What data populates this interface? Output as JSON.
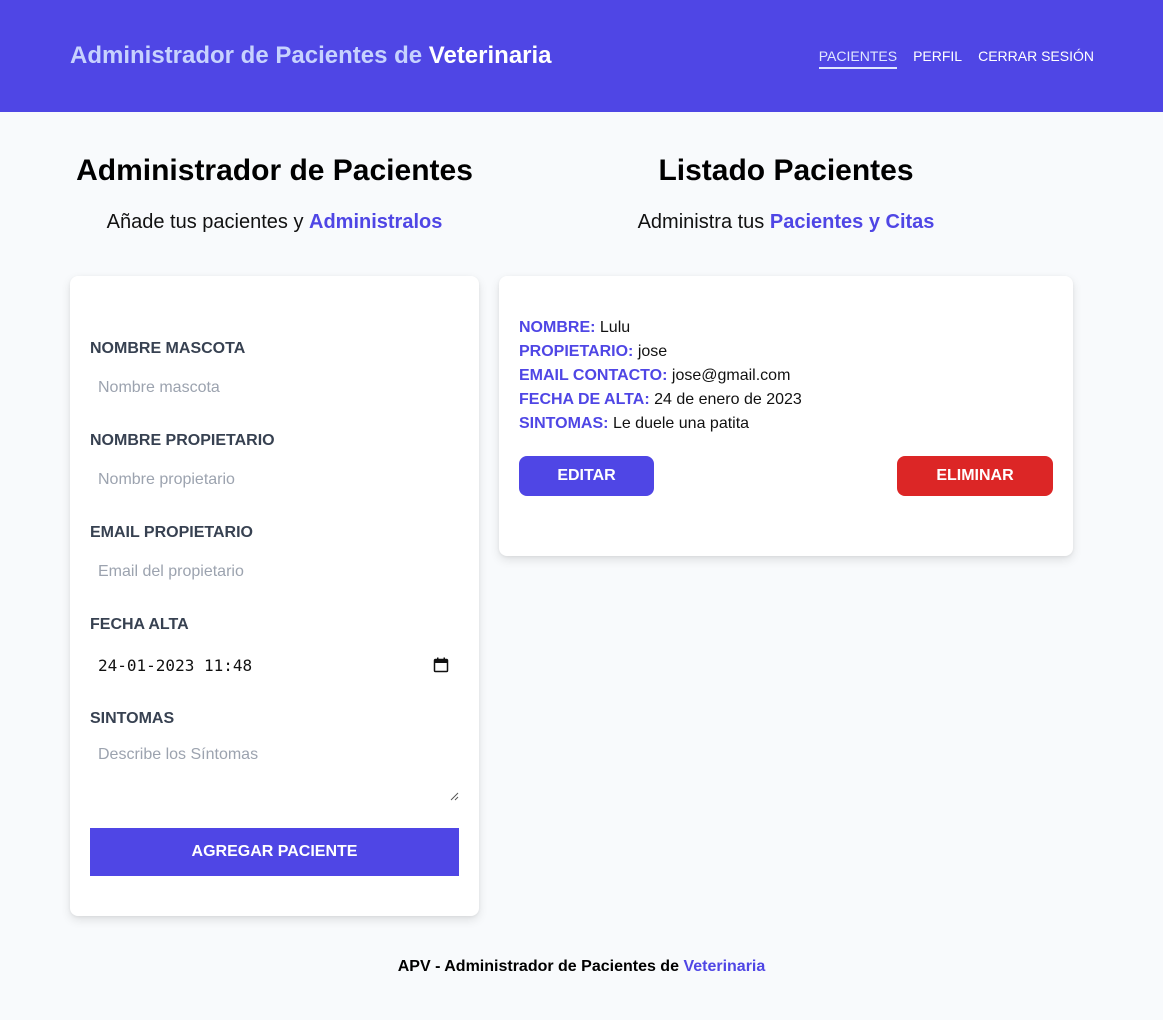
{
  "header": {
    "brand_prefix": "Administrador de Pacientes de",
    "brand_strong": "Veterinaria",
    "nav": [
      {
        "label": "Pacientes",
        "active": true
      },
      {
        "label": "Perfil",
        "active": false
      },
      {
        "label": "Cerrar Sesión",
        "active": false
      }
    ]
  },
  "left": {
    "title": "Administrador de Pacientes",
    "subtitle_prefix": "Añade tus pacientes y",
    "subtitle_accent": "Administralos"
  },
  "right": {
    "title": "Listado Pacientes",
    "subtitle_prefix": "Administra tus",
    "subtitle_accent": "Pacientes y Citas"
  },
  "form": {
    "pet_name": {
      "label": "Nombre Mascota",
      "placeholder": "Nombre mascota",
      "value": ""
    },
    "owner_name": {
      "label": "Nombre Propietario",
      "placeholder": "Nombre propietario",
      "value": ""
    },
    "owner_email": {
      "label": "Email Propietario",
      "placeholder": "Email del propietario",
      "value": ""
    },
    "date": {
      "label": "Fecha Alta",
      "value": "24-01-2023 11:48"
    },
    "symptoms": {
      "label": "Sintomas",
      "placeholder": "Describe los Síntomas",
      "value": ""
    },
    "submit_label": "Agregar Paciente"
  },
  "patient": {
    "name_label": "Nombre:",
    "name": "Lulu",
    "owner_label": "Propietario:",
    "owner": "jose",
    "email_label": "Email Contacto:",
    "email": "jose@gmail.com",
    "date_label": "Fecha de Alta:",
    "date": "24 de enero de 2023",
    "symptoms_label": "Sintomas:",
    "symptoms": "Le duele una patita",
    "edit_label": "Editar",
    "delete_label": "Eliminar"
  },
  "footer": {
    "prefix": "APV - Administrador de Pacientes de",
    "accent": "Veterinaria"
  },
  "colors": {
    "primary": "#4f46e5",
    "danger": "#dc2626",
    "background": "#f8fafc"
  }
}
